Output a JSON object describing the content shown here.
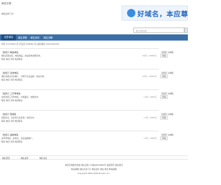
{
  "header": {
    "site_title": "域名交易",
    "site_sub": "域名出售门户",
    "banner_text": "好域名，本应尊",
    "search_placeholder": "输入搜索内容"
  },
  "nav": {
    "items": [
      "出售域名",
      "域名求购",
      "域名资讯",
      "域名详解"
    ]
  },
  "info": "共有 21110000 条 [已显示 408084 条] 最新更新 20191001004",
  "listings": [
    {
      "title": "【出售】精品域名",
      "lines": [
        "域名资源充足，域名精品，欢迎来电详细咨询。",
        "联系 电话 手机 电话联系"
      ],
      "meta": "08月 | 18888元"
    },
    {
      "title": "【出售】双拼域名",
      "lines": [
        "域名优质好记易推广，可用于企业品牌，欢迎咨询。",
        "联系 电话 手机 电话联系"
      ],
      "meta": "09月 | 16888元"
    },
    {
      "title": "【出售】三字母域名",
      "lines": [
        "出售优质三字母域名，价格面议，诚邀合作。",
        "联系 电话 手机 电话联系"
      ],
      "meta": "10月 | 9888元"
    },
    {
      "title": "【出售】短域名",
      "lines": [
        "简短好记，适合各行业使用，欢迎议价。",
        "联系 电话 手机 电话联系"
      ],
      "meta": "11月 | 6888元"
    },
    {
      "title": "【出售】品牌域名",
      "lines": [
        "多年老域名，权重高，适合品牌推广。",
        "联系 电话 手机 电话联系"
      ],
      "meta": "12月 | 5888元"
    }
  ],
  "side": [
    {
      "title": "【出售】好域名",
      "btn": "查看"
    },
    {
      "title": "【出售】好域名",
      "btn": "查看"
    },
    {
      "title": "【出售】好域名",
      "btn": "查看"
    },
    {
      "title": "【出售】好域名",
      "btn": "查看"
    },
    {
      "title": "【出售】好域名",
      "btn": "查看"
    }
  ],
  "pager": [
    "域名首页",
    "域名资讯",
    "域名论坛"
  ],
  "footer": {
    "line1": "电话咨询服务热线 域名出售 ICP备08008888号 版权所有 联系我们",
    "line2": "联系邮箱 域名交易门户 域名出售 地址 电话 网站地图",
    "line3": "Copyright 2009-2018 Domain Inc."
  },
  "colors": {
    "nav_bg": "#3b6fa8",
    "nav_active": "#1f4f86",
    "banner_text": "#2b6cc4",
    "price": "#cc3333"
  }
}
